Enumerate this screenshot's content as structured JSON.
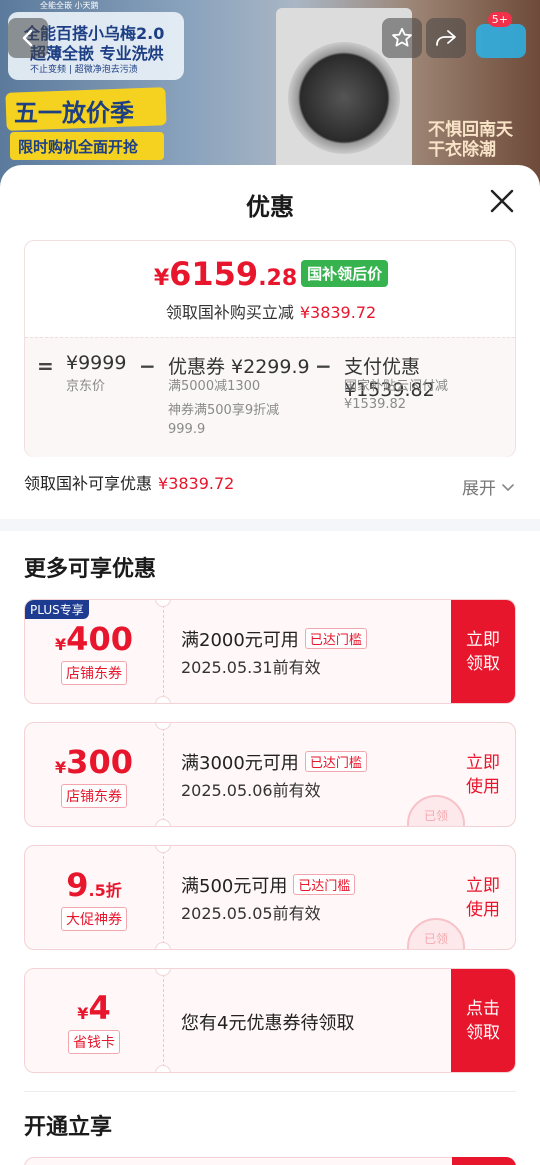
{
  "banner": {
    "top_strip": "全能全嵌 小天鹅",
    "promo_line1": "全能百搭小乌梅2.0",
    "promo_line2": "超薄全嵌 专业洗烘",
    "promo_line3": "不止变频 | 超微净泡去污渍",
    "sale": "五一放价季",
    "limit": "限时购机全面开抢",
    "right_text": "不惧回南天 干衣除潮",
    "more_count": "5+"
  },
  "sheet": {
    "title": "优惠",
    "price": {
      "yen": "¥",
      "integer": "6159",
      "decimal": ".28",
      "tag": "国补领后价",
      "sub_label": "领取国补购买立减",
      "sub_value": "¥3839.72"
    },
    "calc": {
      "eq": "=",
      "base_value": "¥9999",
      "base_label": "京东价",
      "minus1": "−",
      "coupon_value": "优惠券 ¥2299.9",
      "coupon_sub1": "满5000减1300",
      "coupon_sub2": "神券满500享9折减",
      "coupon_sub3": "999.9",
      "minus2": "−",
      "pay_value": "支付优惠 ¥1539.82",
      "pay_sub1": "国家补贴云闪付减",
      "pay_sub2": "¥1539.82"
    },
    "enjoy_label": "领取国补可享优惠",
    "enjoy_value": "¥3839.72",
    "expand": "展开"
  },
  "more": {
    "title": "更多可享优惠",
    "coupons": [
      {
        "plus": "PLUS专享",
        "yen": "¥",
        "amount": "400",
        "suffix": "",
        "type": "店铺东券",
        "condition": "满2000元可用",
        "reached": "已达门槛",
        "valid": "2025.05.31前有效",
        "action": "立即\n领取"
      },
      {
        "yen": "¥",
        "amount": "300",
        "suffix": "",
        "type": "店铺东券",
        "condition": "满3000元可用",
        "reached": "已达门槛",
        "valid": "2025.05.06前有效",
        "action": "立即\n使用",
        "stamp": "已领"
      },
      {
        "yen": "",
        "amount": "9",
        "suffix": ".5折",
        "type": "大促神券",
        "condition": "满500元可用",
        "reached": "已达门槛",
        "valid": "2025.05.05前有效",
        "action": "立即\n使用",
        "stamp": "已领"
      },
      {
        "yen": "¥",
        "amount": "4",
        "suffix": "",
        "type": "省钱卡",
        "text": "您有4元优惠券待领取",
        "action": "点击\n领取"
      }
    ]
  },
  "open": {
    "title": "开通立享"
  }
}
